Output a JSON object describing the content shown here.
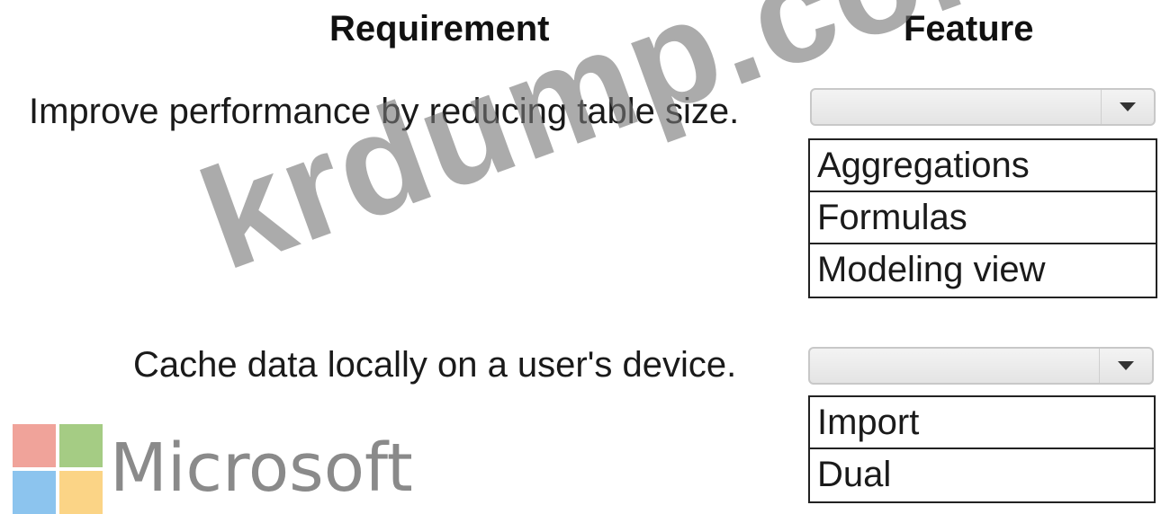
{
  "headers": {
    "requirement": "Requirement",
    "feature": "Feature"
  },
  "rows": [
    {
      "requirement": "Improve performance by reducing table size.",
      "selected_value": "",
      "options": [
        "Aggregations",
        "Formulas",
        "Modeling view"
      ]
    },
    {
      "requirement": "Cache data locally on a user's device.",
      "selected_value": "",
      "options": [
        "Import",
        "Dual"
      ]
    }
  ],
  "watermark": "krdump.com",
  "logo": {
    "wordmark": "Microsoft",
    "colors": [
      "#f0a39a",
      "#a5cc84",
      "#8cc4ee",
      "#fbd486"
    ]
  }
}
